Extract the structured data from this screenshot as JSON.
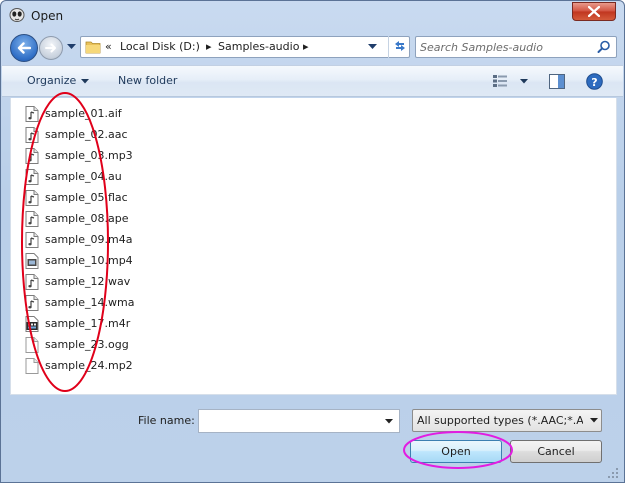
{
  "window": {
    "title": "Open",
    "close_icon": "close-icon"
  },
  "address": {
    "overflow": "«",
    "segments": [
      "Local Disk (D:)",
      "Samples-audio"
    ],
    "separator": "▸"
  },
  "search": {
    "placeholder": "Search Samples-audio",
    "value": ""
  },
  "toolbar": {
    "organize_label": "Organize",
    "new_folder_label": "New folder"
  },
  "files": [
    {
      "name": "sample_01.aif",
      "icon": "audio-file-icon"
    },
    {
      "name": "sample_02.aac",
      "icon": "audio-file-icon"
    },
    {
      "name": "sample_03.mp3",
      "icon": "audio-file-icon"
    },
    {
      "name": "sample_04.au",
      "icon": "audio-file-icon"
    },
    {
      "name": "sample_05.flac",
      "icon": "audio-file-icon"
    },
    {
      "name": "sample_08.ape",
      "icon": "audio-file-icon"
    },
    {
      "name": "sample_09.m4a",
      "icon": "audio-file-icon"
    },
    {
      "name": "sample_10.mp4",
      "icon": "video-file-icon"
    },
    {
      "name": "sample_12.wav",
      "icon": "audio-file-icon"
    },
    {
      "name": "sample_14.wma",
      "icon": "audio-file-icon"
    },
    {
      "name": "sample_17.m4r",
      "icon": "media-file-icon"
    },
    {
      "name": "sample_23.ogg",
      "icon": "blank-file-icon"
    },
    {
      "name": "sample_24.mp2",
      "icon": "blank-file-icon"
    }
  ],
  "footer": {
    "file_name_label": "File name:",
    "file_name_value": "",
    "filter_selected": "All supported types (*.AAC;*.AI",
    "open_label": "Open",
    "cancel_label": "Cancel"
  },
  "colors": {
    "annotation_red": "#e0001a",
    "annotation_magenta": "#e21ce2",
    "link_blue": "#1e395b"
  }
}
